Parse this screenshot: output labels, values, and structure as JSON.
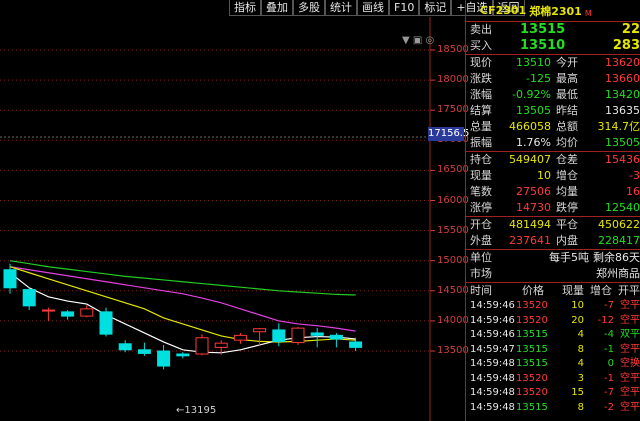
{
  "toolbar": {
    "buttons": [
      "指标",
      "叠加",
      "多股",
      "统计",
      "画线",
      "F10",
      "标记",
      "+自选",
      "返回"
    ]
  },
  "chart": {
    "y_labels": [
      "18500",
      "18000",
      "17500",
      "17000",
      "16500",
      "16000",
      "15500",
      "15000",
      "14500",
      "14000",
      "13500"
    ],
    "price_tag": "17156.5",
    "low_label": "←13195",
    "icons": "▼ ▣ ◎"
  },
  "colors": {
    "up": "#ff3a3a",
    "down": "#00e0e0",
    "ma5": "#ffffff",
    "ma10": "#e6e600",
    "ma20": "#e040e0",
    "ma60": "#22cc22"
  },
  "candles": [
    {
      "o": 14850,
      "c": 14550,
      "h": 14950,
      "l": 14450
    },
    {
      "o": 14520,
      "c": 14250,
      "h": 14560,
      "l": 14180
    },
    {
      "o": 14180,
      "c": 14180,
      "h": 14220,
      "l": 14000
    },
    {
      "o": 14150,
      "c": 14080,
      "h": 14180,
      "l": 14020
    },
    {
      "o": 14080,
      "c": 14200,
      "h": 14260,
      "l": 14060
    },
    {
      "o": 14150,
      "c": 13780,
      "h": 14220,
      "l": 13740
    },
    {
      "o": 13620,
      "c": 13520,
      "h": 13680,
      "l": 13480
    },
    {
      "o": 13520,
      "c": 13460,
      "h": 13640,
      "l": 13420
    },
    {
      "o": 13500,
      "c": 13250,
      "h": 13600,
      "l": 13195
    },
    {
      "o": 13450,
      "c": 13420,
      "h": 13480,
      "l": 13380
    },
    {
      "o": 13450,
      "c": 13720,
      "h": 13780,
      "l": 13430
    },
    {
      "o": 13560,
      "c": 13630,
      "h": 13680,
      "l": 13440
    },
    {
      "o": 13680,
      "c": 13760,
      "h": 13800,
      "l": 13620
    },
    {
      "o": 13820,
      "c": 13870,
      "h": 13880,
      "l": 13580
    },
    {
      "o": 13850,
      "c": 13660,
      "h": 13960,
      "l": 13580
    },
    {
      "o": 13640,
      "c": 13880,
      "h": 13900,
      "l": 13600
    },
    {
      "o": 13800,
      "c": 13760,
      "h": 13880,
      "l": 13560
    },
    {
      "o": 13760,
      "c": 13700,
      "h": 13800,
      "l": 13560
    },
    {
      "o": 13650,
      "c": 13560,
      "h": 13720,
      "l": 13500
    }
  ],
  "ma5": [
    14800,
    14550,
    14400,
    14330,
    14280,
    14100,
    13950,
    13800,
    13650,
    13520,
    13480,
    13470,
    13520,
    13600,
    13680,
    13720,
    13740,
    13730,
    13700
  ],
  "ma10": [
    14900,
    14800,
    14700,
    14600,
    14500,
    14400,
    14300,
    14200,
    14050,
    13950,
    13850,
    13750,
    13690,
    13660,
    13650,
    13660,
    13680,
    13700,
    13680
  ],
  "ma20": [
    14900,
    14850,
    14800,
    14750,
    14700,
    14650,
    14600,
    14550,
    14500,
    14450,
    14380,
    14300,
    14200,
    14100,
    14000,
    13950,
    13920,
    13880,
    13830
  ],
  "ma60": [
    15000,
    14950,
    14900,
    14860,
    14820,
    14780,
    14740,
    14710,
    14680,
    14650,
    14620,
    14590,
    14560,
    14530,
    14500,
    14480,
    14460,
    14440,
    14430
  ],
  "panel": {
    "code": "CF2301",
    "name": "郑棉2301",
    "badge": "M",
    "bidask": [
      {
        "label": "卖出",
        "price": "13515",
        "vol": "22"
      },
      {
        "label": "买入",
        "price": "13510",
        "vol": "283"
      }
    ],
    "quote": [
      {
        "l1": "现价",
        "v1": "13510",
        "c1": "g",
        "l2": "今开",
        "v2": "13620",
        "c2": "r"
      },
      {
        "l1": "涨跌",
        "v1": "-125",
        "c1": "g",
        "l2": "最高",
        "v2": "13660",
        "c2": "r"
      },
      {
        "l1": "涨幅",
        "v1": "-0.92%",
        "c1": "g",
        "l2": "最低",
        "v2": "13420",
        "c2": "g"
      },
      {
        "l1": "结算",
        "v1": "13505",
        "c1": "g",
        "l2": "昨结",
        "v2": "13635",
        "c2": "w"
      },
      {
        "l1": "总量",
        "v1": "466058",
        "c1": "y",
        "l2": "总额",
        "v2": "314.7亿",
        "c2": "y"
      },
      {
        "l1": "振幅",
        "v1": "1.76%",
        "c1": "w",
        "l2": "均价",
        "v2": "13505",
        "c2": "g"
      }
    ],
    "position": [
      {
        "l1": "持仓",
        "v1": "549407",
        "c1": "y",
        "l2": "仓差",
        "v2": "15436",
        "c2": "r"
      },
      {
        "l1": "现量",
        "v1": "10",
        "c1": "y",
        "l2": "增仓",
        "v2": "-3",
        "c2": "r"
      },
      {
        "l1": "笔数",
        "v1": "27506",
        "c1": "r",
        "l2": "均量",
        "v2": "16",
        "c2": "r"
      },
      {
        "l1": "涨停",
        "v1": "14730",
        "c1": "r",
        "l2": "跌停",
        "v2": "12540",
        "c2": "g"
      }
    ],
    "openclose": [
      {
        "l1": "开仓",
        "v1": "481494",
        "c1": "y",
        "l2": "平仓",
        "v2": "450622",
        "c2": "y"
      },
      {
        "l1": "外盘",
        "v1": "237641",
        "c1": "r",
        "l2": "内盘",
        "v2": "228417",
        "c2": "g"
      }
    ],
    "unit": {
      "label": "单位",
      "value": "每手5吨",
      "extra": "剩余86天"
    },
    "market": {
      "label": "市场",
      "value": "郑州商品"
    },
    "trade_headers": [
      "时间",
      "价格",
      "现量",
      "增仓",
      "开平"
    ],
    "trades": [
      {
        "t": "14:59:46",
        "p": "13520",
        "pc": "r",
        "q": "10",
        "a": "-7",
        "ac": "r",
        "k": "空平",
        "kc": "r"
      },
      {
        "t": "14:59:46",
        "p": "13520",
        "pc": "r",
        "q": "20",
        "a": "-12",
        "ac": "r",
        "k": "空平",
        "kc": "r"
      },
      {
        "t": "14:59:46",
        "p": "13515",
        "pc": "g",
        "q": "4",
        "a": "-4",
        "ac": "g",
        "k": "双平",
        "kc": "g"
      },
      {
        "t": "14:59:47",
        "p": "13515",
        "pc": "g",
        "q": "8",
        "a": "-1",
        "ac": "g",
        "k": "空平",
        "kc": "r"
      },
      {
        "t": "14:59:48",
        "p": "13515",
        "pc": "g",
        "q": "4",
        "a": "0",
        "ac": "g",
        "k": "空换",
        "kc": "r"
      },
      {
        "t": "14:59:48",
        "p": "13520",
        "pc": "r",
        "q": "3",
        "a": "-1",
        "ac": "r",
        "k": "空平",
        "kc": "r"
      },
      {
        "t": "14:59:48",
        "p": "13520",
        "pc": "r",
        "q": "15",
        "a": "-7",
        "ac": "r",
        "k": "空平",
        "kc": "r"
      },
      {
        "t": "14:59:48",
        "p": "13515",
        "pc": "g",
        "q": "8",
        "a": "-2",
        "ac": "r",
        "k": "空平",
        "kc": "r"
      }
    ]
  }
}
